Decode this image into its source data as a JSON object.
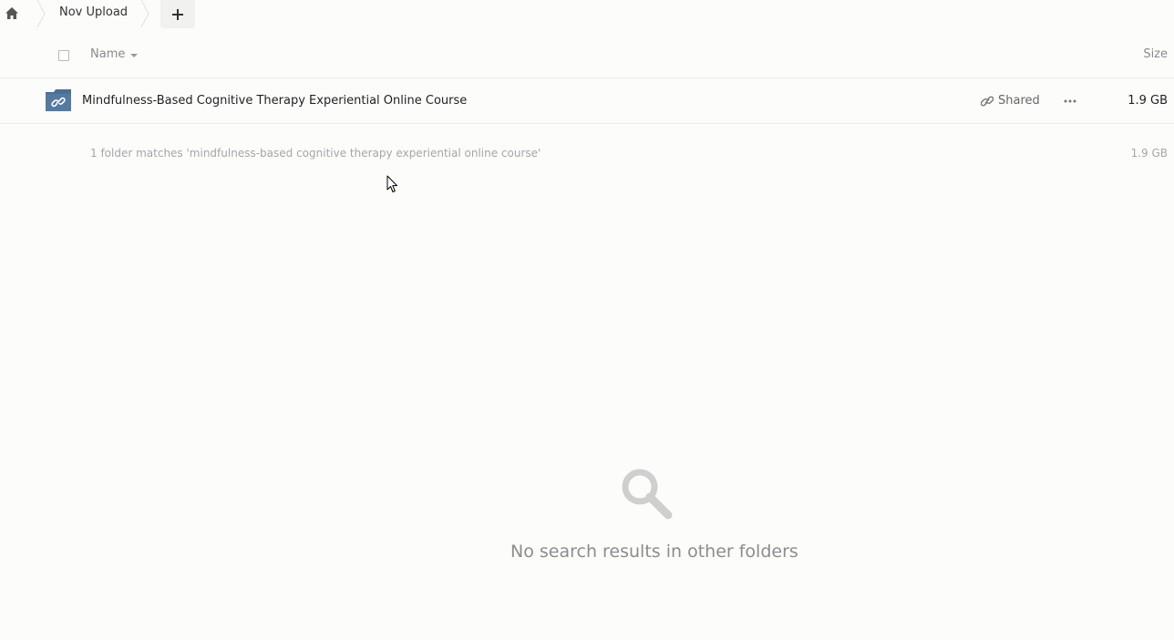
{
  "breadcrumb": {
    "home_icon": "home-icon",
    "current_folder": "Nov Upload",
    "new_icon": "plus-icon"
  },
  "list_header": {
    "name_label": "Name",
    "size_label": "Size"
  },
  "files": [
    {
      "name": "Mindfulness-Based Cognitive Therapy Experiential Online Course",
      "icon": "shared-folder-icon",
      "share_label": "Shared",
      "size": "1.9 GB"
    }
  ],
  "summary": {
    "text": "1 folder matches 'mindfulness-based cognitive therapy experiential online course'",
    "size": "1.9 GB"
  },
  "empty_state": {
    "icon": "search-icon",
    "message": "No search results in other folders"
  },
  "colors": {
    "folder": "#4a6e94",
    "background": "#fcfcfb"
  }
}
